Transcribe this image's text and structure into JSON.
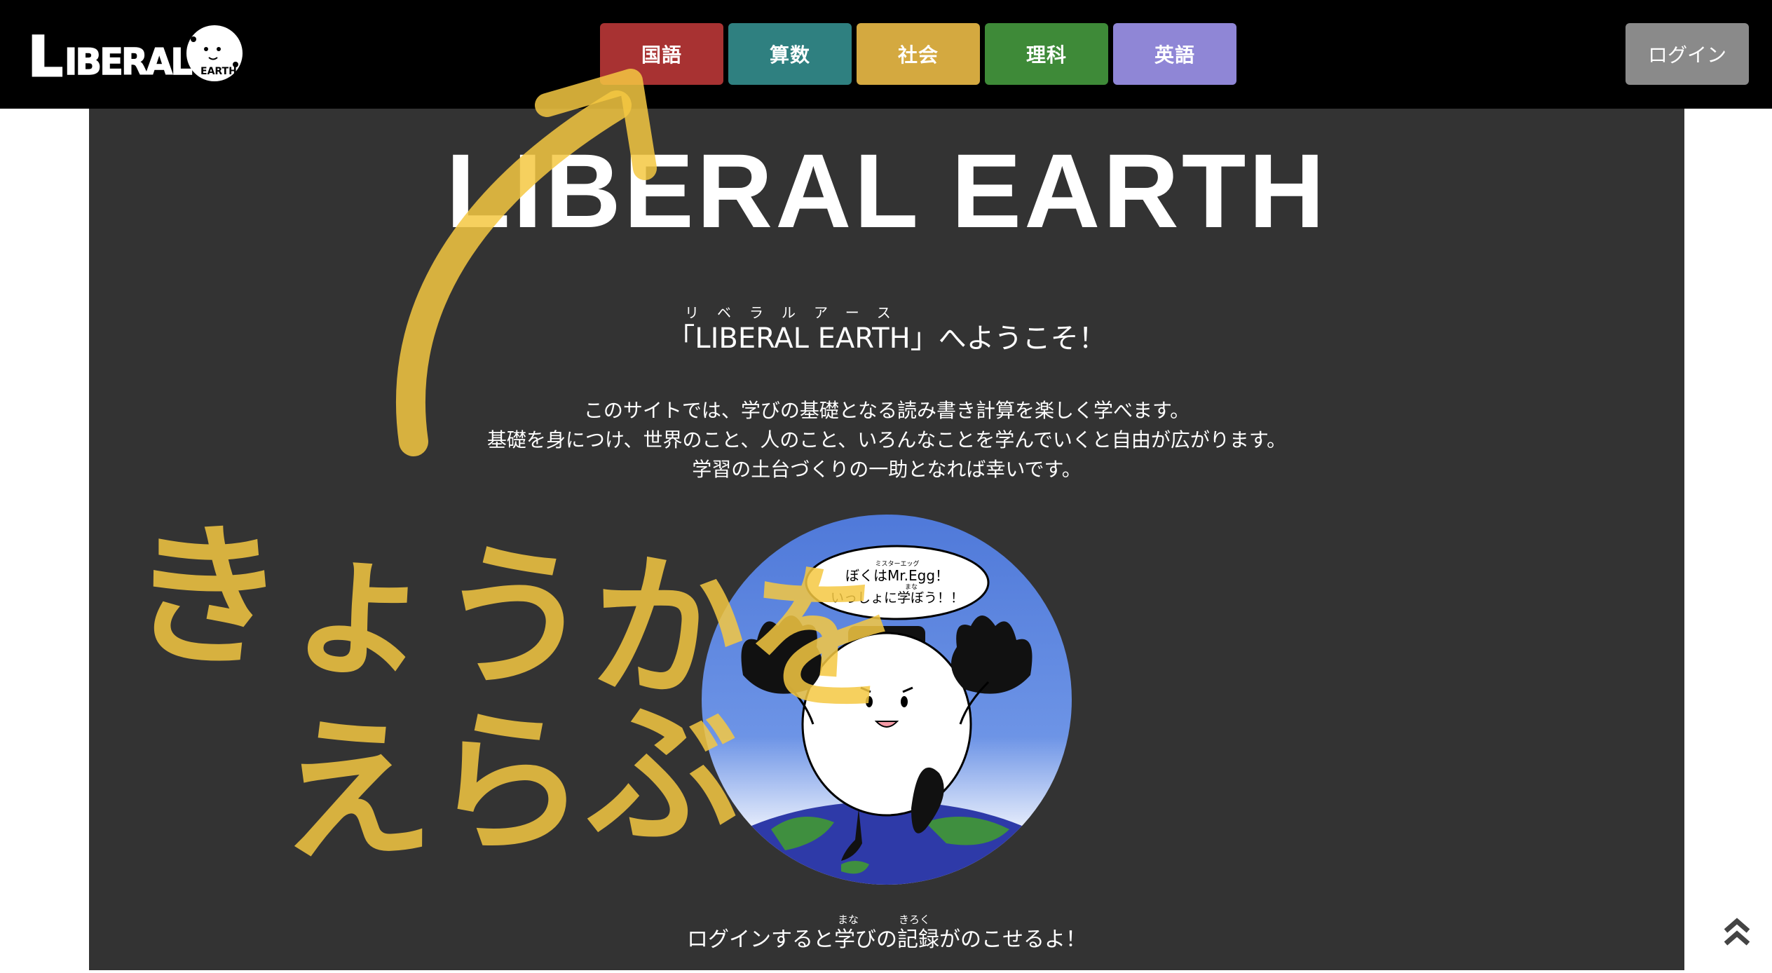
{
  "header": {
    "logo_text": "LIBERAL EARTH",
    "subjects": [
      {
        "label": "国語",
        "color": "#a83232"
      },
      {
        "label": "算数",
        "color": "#2f8080"
      },
      {
        "label": "社会",
        "color": "#d4a940"
      },
      {
        "label": "理科",
        "color": "#3e8a38"
      },
      {
        "label": "英語",
        "color": "#8f86d6"
      }
    ],
    "login_label": "ログイン",
    "login_color": "#8a8a8a"
  },
  "main": {
    "title": "LIBERAL EARTH",
    "welcome": "「LIBERAL EARTH」へようこそ！",
    "welcome_ruby": "リベラルアース",
    "intro_lines": [
      "このサイトでは、学びの基礎となる読み書き計算を楽しく学べます。",
      "基礎を身につけ、世界のこと、人のこと、いろんなことを学んでいくと自由が広がります。",
      "学習の土台づくりの一助となれば幸いです。"
    ],
    "mascot": {
      "bubble_ruby": "ミスターエッグ",
      "bubble_line1": "ぼくはMr.Egg！",
      "bubble_ruby2": "まな",
      "bubble_line2": "いっしょに学ぼう！！"
    },
    "footer_text": "ログインすると学びの記録がのこせるよ！",
    "footer_ruby_manabi": "まな",
    "footer_ruby_kiroku": "きろく"
  },
  "overlay": {
    "handwritten_line1": "きょうかを",
    "handwritten_line2": "えらぶ",
    "highlight_color": "#f5c842"
  },
  "icons": {
    "scroll_top": "double-chevron-up-icon"
  }
}
